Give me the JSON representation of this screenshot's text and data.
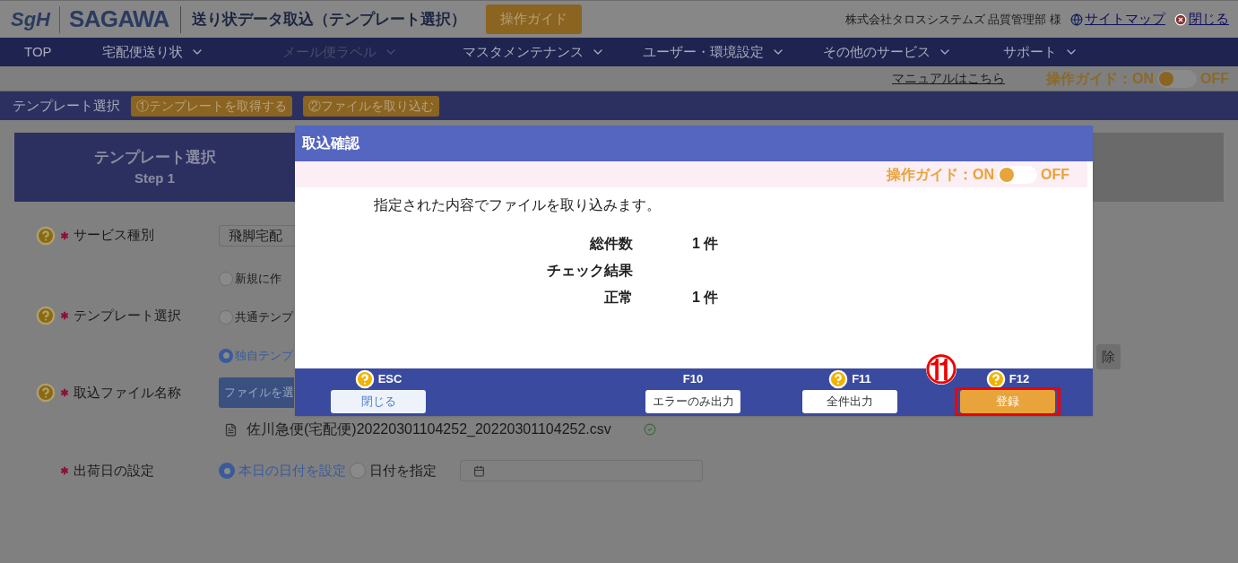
{
  "header": {
    "logo_mark": "SgH",
    "logo": "SAGAWA",
    "title": "送り状データ取込（テンプレート選択）",
    "guide_button": "操作ガイド",
    "user": "株式会社タロスシステムズ 品質管理部 様",
    "links": [
      {
        "label": "サイトマップ",
        "kind": "globe"
      },
      {
        "label": "閉じる",
        "kind": "close"
      }
    ]
  },
  "nav": [
    {
      "label": "TOP",
      "dropdown": false,
      "disabled": false
    },
    {
      "label": "宅配便送り状",
      "dropdown": true,
      "disabled": false
    },
    {
      "label": "メール便ラベル",
      "dropdown": true,
      "disabled": true
    },
    {
      "label": "マスタメンテナンス",
      "dropdown": true,
      "disabled": false
    },
    {
      "label": "ユーザー・環境設定",
      "dropdown": true,
      "disabled": false
    },
    {
      "label": "その他のサービス",
      "dropdown": true,
      "disabled": false
    },
    {
      "label": "サポート",
      "dropdown": true,
      "disabled": false
    }
  ],
  "subbar": {
    "manual_link": "マニュアルはこちら",
    "guide": {
      "label": "操作ガイド：ON",
      "off_label": "OFF",
      "on": true
    }
  },
  "breadcrumb": {
    "current": "テンプレート選択",
    "steps": [
      "①テンプレートを取得する",
      "②ファイルを取り込む"
    ]
  },
  "step_panel": {
    "title": "テンプレート選択",
    "step": "Step 1"
  },
  "form": [
    {
      "label": "サービス種別",
      "help": true,
      "required": true,
      "kind": "select",
      "value": "飛脚宅配"
    },
    {
      "label": "テンプレート選択",
      "help": true,
      "required": true,
      "kind": "radio",
      "options": [
        {
          "label": "新規に作",
          "selected": false
        },
        {
          "label": "共通テンプ",
          "selected": false
        },
        {
          "label": "独自テンプ",
          "selected": true
        }
      ],
      "side_button": "除"
    },
    {
      "label": "取込ファイル名称",
      "help": true,
      "required": true,
      "kind": "file",
      "button": "ファイルを選",
      "file_name": "佐川急便(宅配便)20220301104252_20220301104252.csv"
    },
    {
      "label": "出荷日の設定",
      "help": false,
      "required": true,
      "kind": "date",
      "options": [
        {
          "label": "本日の日付を設定",
          "selected": true
        },
        {
          "label": "日付を指定",
          "selected": false
        }
      ]
    }
  ],
  "dialog": {
    "title": "取込確認",
    "guide": {
      "label": "操作ガイド：ON",
      "off_label": "OFF",
      "on": true
    },
    "message": "指定された内容でファイルを取り込みます。",
    "summary": [
      {
        "label": "総件数",
        "value": "1 件"
      },
      {
        "label": "チェック結果"
      },
      {
        "label": "正常",
        "value": "1 件"
      }
    ],
    "buttons": [
      {
        "key": "ESC",
        "help": true,
        "label": "閉じる",
        "kind": "light"
      },
      {
        "key": "F10",
        "help": false,
        "label": "エラーのみ出力",
        "kind": "plain"
      },
      {
        "key": "F11",
        "help": true,
        "label": "全件出力",
        "kind": "plain"
      },
      {
        "key": "F12",
        "help": true,
        "label": "登録",
        "kind": "primary",
        "callout": "⑪"
      }
    ]
  }
}
